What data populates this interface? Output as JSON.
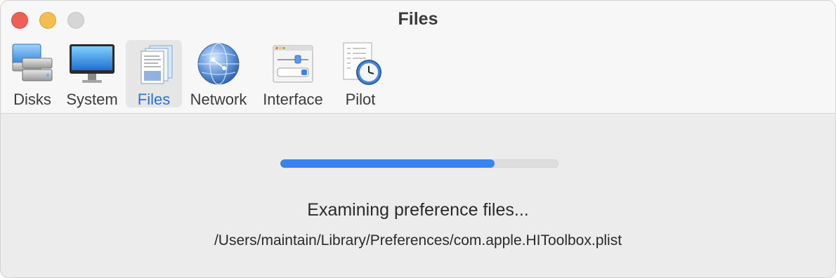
{
  "window": {
    "title": "Files"
  },
  "toolbar": {
    "items": [
      {
        "label": "Disks",
        "icon": "disks-icon",
        "selected": false
      },
      {
        "label": "System",
        "icon": "monitor-icon",
        "selected": false
      },
      {
        "label": "Files",
        "icon": "documents-icon",
        "selected": true
      },
      {
        "label": "Network",
        "icon": "globe-icon",
        "selected": false
      },
      {
        "label": "Interface",
        "icon": "interface-window-icon",
        "selected": false
      },
      {
        "label": "Pilot",
        "icon": "pilot-clock-icon",
        "selected": false
      }
    ]
  },
  "progress": {
    "value_percent": 77,
    "status": "Examining preference files...",
    "path": "/Users/maintain/Library/Preferences/com.apple.HIToolbox.plist"
  },
  "colors": {
    "accent": "#3b82f1",
    "selected_label": "#2f6fd6",
    "close": "#ee5f57",
    "minimize": "#f5bd4f",
    "zoom_inactive": "#d6d6d6"
  }
}
